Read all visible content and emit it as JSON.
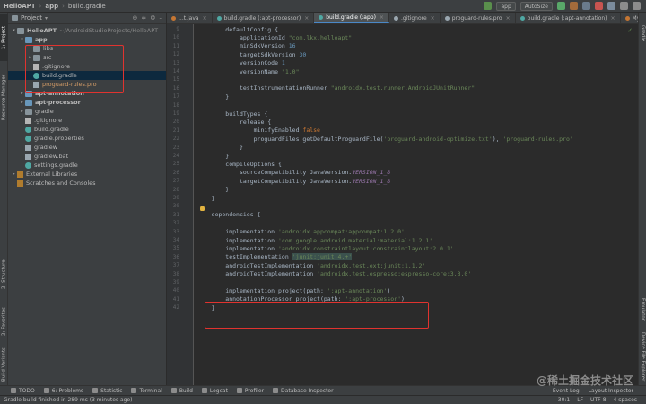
{
  "nav": {
    "project": "HelloAPT",
    "module": "app",
    "file": "build.gradle",
    "run_config": "app",
    "sync_mode": "AutoSize"
  },
  "project_panel": {
    "title": "Project",
    "items": [
      {
        "label": "HelloAPT",
        "extra": "~/AndroidStudioProjects/HelloAPT",
        "icon": "folder-icon",
        "depth": 0,
        "expanded": true,
        "bold": true
      },
      {
        "label": "app",
        "icon": "module-folder-icon",
        "depth": 1,
        "expanded": true,
        "bold": true
      },
      {
        "label": "libs",
        "icon": "folder-icon",
        "depth": 2,
        "expanded": false
      },
      {
        "label": "src",
        "icon": "folder-icon",
        "depth": 2,
        "expanded": false,
        "collapsed_arrow": true
      },
      {
        "label": ".gitignore",
        "icon": "git-file-icon",
        "depth": 2
      },
      {
        "label": "build.gradle",
        "icon": "gradle-file-icon",
        "depth": 2,
        "selected": true
      },
      {
        "label": "proguard-rules.pro",
        "icon": "text-file-icon",
        "depth": 2
      },
      {
        "label": "apt-annotation",
        "icon": "module-folder-icon",
        "depth": 1,
        "collapsed_arrow": true,
        "bold": true
      },
      {
        "label": "apt-processor",
        "icon": "module-folder-icon",
        "depth": 1,
        "collapsed_arrow": true,
        "bold": true
      },
      {
        "label": "gradle",
        "icon": "folder-icon",
        "depth": 1,
        "collapsed_arrow": true
      },
      {
        "label": ".gitignore",
        "icon": "git-file-icon",
        "depth": 1
      },
      {
        "label": "build.gradle",
        "icon": "gradle-file-icon",
        "depth": 1
      },
      {
        "label": "gradle.properties",
        "icon": "gradle-file-icon",
        "depth": 1
      },
      {
        "label": "gradlew",
        "icon": "text-file-icon",
        "depth": 1
      },
      {
        "label": "gradlew.bat",
        "icon": "text-file-icon",
        "depth": 1
      },
      {
        "label": "settings.gradle",
        "icon": "gradle-file-icon",
        "depth": 1
      },
      {
        "label": "External Libraries",
        "icon": "libraries-icon",
        "depth": 0,
        "collapsed_arrow": true
      },
      {
        "label": "Scratches and Consoles",
        "icon": "scratches-icon",
        "depth": 0
      }
    ]
  },
  "left_tabs": [
    "1: Project",
    "Resource Manager",
    "2: Structure",
    "2: Favorites",
    "Build Variants"
  ],
  "right_tabs": [
    "Gradle",
    "Emulator",
    "Device File Explorer"
  ],
  "editor_tabs": [
    {
      "label": "...t.java",
      "active": false
    },
    {
      "label": "build.gradle (:apt-processor)",
      "active": false
    },
    {
      "label": "build.gradle (:app)",
      "active": true
    },
    {
      "label": ".gitignore",
      "active": false
    },
    {
      "label": "proguard-rules.pro",
      "active": false
    },
    {
      "label": "build.gradle (:apt-annotation)",
      "active": false
    },
    {
      "label": "MyProcessor.java",
      "active": false
    }
  ],
  "code_lines": [
    {
      "n": "9",
      "text": "        defaultConfig {"
    },
    {
      "n": "10",
      "text": "            applicationId \"com.lkx.helloapt\""
    },
    {
      "n": "11",
      "text": "            minSdkVersion 16"
    },
    {
      "n": "12",
      "text": "            targetSdkVersion 30"
    },
    {
      "n": "13",
      "text": "            versionCode 1"
    },
    {
      "n": "14",
      "text": "            versionName \"1.0\""
    },
    {
      "n": "15",
      "text": ""
    },
    {
      "n": "16",
      "text": "            testInstrumentationRunner \"androidx.test.runner.AndroidJUnitRunner\""
    },
    {
      "n": "17",
      "text": "        }"
    },
    {
      "n": "18",
      "text": ""
    },
    {
      "n": "19",
      "text": "        buildTypes {"
    },
    {
      "n": "20",
      "text": "            release {"
    },
    {
      "n": "21",
      "text": "                minifyEnabled false"
    },
    {
      "n": "22",
      "text": "                proguardFiles getDefaultProguardFile('proguard-android-optimize.txt'), 'proguard-rules.pro'"
    },
    {
      "n": "23",
      "text": "            }"
    },
    {
      "n": "24",
      "text": "        }"
    },
    {
      "n": "25",
      "text": "        compileOptions {"
    },
    {
      "n": "26",
      "text": "            sourceCompatibility JavaVersion.VERSION_1_8"
    },
    {
      "n": "27",
      "text": "            targetCompatibility JavaVersion.VERSION_1_8"
    },
    {
      "n": "28",
      "text": "        }"
    },
    {
      "n": "29",
      "text": "    }"
    },
    {
      "n": "30",
      "text": ""
    },
    {
      "n": "31",
      "text": "    dependencies {"
    },
    {
      "n": "32",
      "text": ""
    },
    {
      "n": "33",
      "text": "        implementation 'androidx.appcompat:appcompat:1.2.0'"
    },
    {
      "n": "34",
      "text": "        implementation 'com.google.android.material:material:1.2.1'"
    },
    {
      "n": "35",
      "text": "        implementation 'androidx.constraintlayout:constraintlayout:2.0.1'"
    },
    {
      "n": "36",
      "text": "        testImplementation 'junit:junit:4.+'"
    },
    {
      "n": "37",
      "text": "        androidTestImplementation 'androidx.test.ext:junit:1.1.2'"
    },
    {
      "n": "38",
      "text": "        androidTestImplementation 'androidx.test.espresso:espresso-core:3.3.0'"
    },
    {
      "n": "39",
      "text": ""
    },
    {
      "n": "40",
      "text": "        implementation project(path: ':apt-annotation')"
    },
    {
      "n": "41",
      "text": "        annotationProcessor project(path: ':apt-processor')"
    },
    {
      "n": "42",
      "text": "    }"
    }
  ],
  "bottom_tools": [
    {
      "label": "TODO",
      "icon": "todo-icon"
    },
    {
      "label": "6: Problems",
      "icon": "problems-icon"
    },
    {
      "label": "Statistic",
      "icon": "statistic-icon"
    },
    {
      "label": "Terminal",
      "icon": "terminal-icon"
    },
    {
      "label": "Build",
      "icon": "build-icon"
    },
    {
      "label": "Logcat",
      "icon": "logcat-icon"
    },
    {
      "label": "Profiler",
      "icon": "profiler-icon"
    },
    {
      "label": "Database Inspector",
      "icon": "database-icon"
    }
  ],
  "bottom_right": [
    "Event Log",
    "Layout Inspector"
  ],
  "status": {
    "message": "Gradle build finished in 289 ms (3 minutes ago)",
    "position": "30:1",
    "line_sep": "LF",
    "encoding": "UTF-8",
    "indent": "4 spaces"
  },
  "watermark": "@稀土掘金技术社区",
  "colors": {
    "highlight_box": "#e0332f",
    "keyword": "#cc7832",
    "string": "#6a8759",
    "number": "#6897bb",
    "constant": "#9876aa"
  }
}
